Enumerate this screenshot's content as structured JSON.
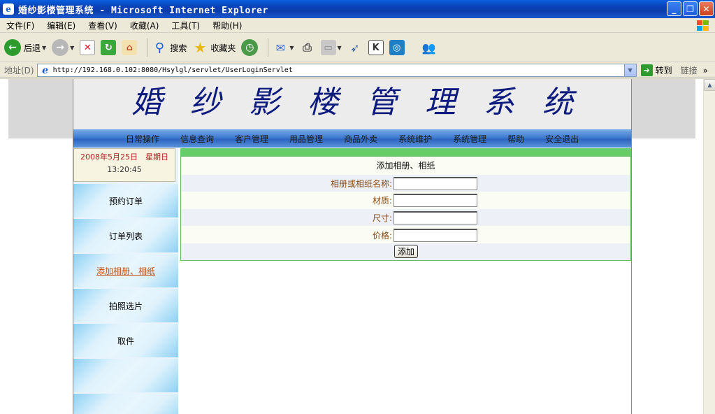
{
  "window": {
    "title": "婚纱影楼管理系统 - Microsoft Internet Explorer",
    "minimize": "_",
    "restore": "❐",
    "close": "✕"
  },
  "menubar": {
    "items": [
      "文件(F)",
      "编辑(E)",
      "查看(V)",
      "收藏(A)",
      "工具(T)",
      "帮助(H)"
    ]
  },
  "toolbar": {
    "back": "后退",
    "search": "搜索",
    "favorites": "收藏夹"
  },
  "address": {
    "label": "地址(D)",
    "url": "http://192.168.0.102:8080/Hsylgl/servlet/UserLoginServlet",
    "go": "转到",
    "links": "链接"
  },
  "site": {
    "title": "婚纱影楼管理系统",
    "nav": [
      "日常操作",
      "信息查询",
      "客户管理",
      "用品管理",
      "商品外卖",
      "系统维护",
      "系统管理",
      "帮助",
      "安全退出"
    ],
    "date": "2008年5月25日　星期日",
    "time": "13:20:45",
    "sidebar": [
      "预约订单",
      "订单列表",
      "添加相册、相纸",
      "拍照选片",
      "取件",
      "",
      ""
    ]
  },
  "form": {
    "title": "添加相册、相纸",
    "fields": [
      {
        "label": "相册或相纸名称:",
        "value": ""
      },
      {
        "label": "材质:",
        "value": ""
      },
      {
        "label": "尺寸:",
        "value": ""
      },
      {
        "label": "价格:",
        "value": ""
      }
    ],
    "submit": "添加"
  },
  "colors": {
    "banner_text": "#0d1a7e",
    "nav_blue": "#3e7bd0",
    "green_accent": "#66cc66",
    "label_brown": "#8a4a10",
    "date_red": "#b02020"
  }
}
